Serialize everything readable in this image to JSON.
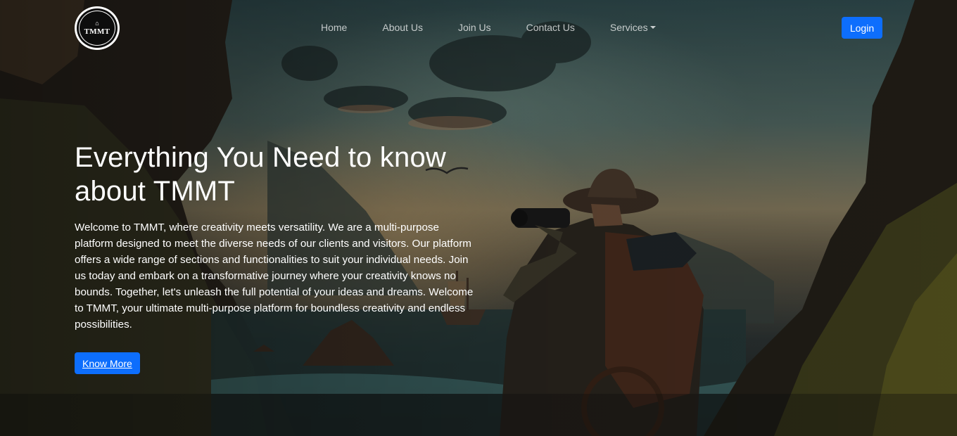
{
  "brand": {
    "logo_text": "TMMT",
    "logo_glyph": "⌂"
  },
  "nav": {
    "items": [
      {
        "label": "Home"
      },
      {
        "label": "About Us"
      },
      {
        "label": "Join Us"
      },
      {
        "label": "Contact Us"
      },
      {
        "label": "Services"
      }
    ],
    "login_label": "Login"
  },
  "hero": {
    "title": "Everything You Need to know about TMMT",
    "description": "Welcome to TMMT, where creativity meets versatility. We are a multi-purpose platform designed to meet the diverse needs of our clients and visitors. Our platform offers a wide range of sections and functionalities to suit your individual needs. Join us today and embark on a transformative journey where your creativity knows no bounds. Together, let's unleash the full potential of your ideas and dreams. Welcome to TMMT, your ultimate multi-purpose platform for boundless creativity and endless possibilities.",
    "cta_label": "Know More"
  },
  "colors": {
    "primary_button": "#0d6efd",
    "nav_text": "rgba(255,255,255,0.72)"
  },
  "icons": {
    "services_dropdown": "caret-down-icon"
  }
}
